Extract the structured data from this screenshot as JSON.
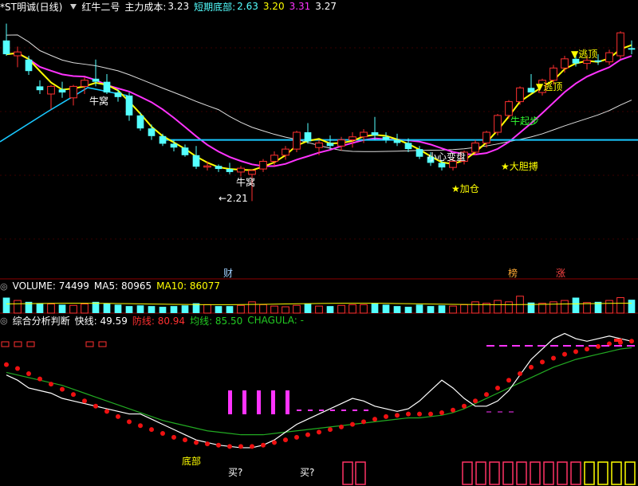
{
  "header": {
    "stock": "*ST明诚(日线)",
    "indicator": "红牛二号",
    "cost_label": "主力成本:",
    "cost_value": "3.23",
    "bottom_label": "短期底部:",
    "bottom_value": "2.63",
    "v1": "3.20",
    "v2": "3.31",
    "v3": "3.27"
  },
  "colors": {
    "up": "#ff3030",
    "down": "#54ffff",
    "fast": "#ffff00",
    "mid": "#ff33ff",
    "slow": "#dddddd",
    "support": "#19c8ff"
  },
  "main_chart": {
    "type": "candlestick",
    "support_level": 3.0,
    "low_marker": "2.21",
    "labels": {
      "nest1": "牛窝",
      "nest2": "牛窝",
      "small_change": "小心变盘",
      "add_position": "★加仓",
      "bold_buy": "★大胆搏",
      "bull_start": "牛起步",
      "escape1": "▼逃顶",
      "escape2": "▼逃顶"
    },
    "candles": [
      {
        "o": 4.3,
        "h": 4.52,
        "l": 4.1,
        "c": 4.12
      },
      {
        "o": 4.1,
        "h": 4.22,
        "l": 3.95,
        "c": 4.15
      },
      {
        "o": 4.05,
        "h": 4.1,
        "l": 3.85,
        "c": 3.9
      },
      {
        "o": 3.7,
        "h": 3.78,
        "l": 3.6,
        "c": 3.65
      },
      {
        "o": 3.6,
        "h": 3.72,
        "l": 3.4,
        "c": 3.7
      },
      {
        "o": 3.66,
        "h": 3.76,
        "l": 3.55,
        "c": 3.62
      },
      {
        "o": 3.55,
        "h": 3.72,
        "l": 3.45,
        "c": 3.7
      },
      {
        "o": 3.7,
        "h": 3.82,
        "l": 3.6,
        "c": 3.78
      },
      {
        "o": 3.8,
        "h": 4.05,
        "l": 3.7,
        "c": 3.76
      },
      {
        "o": 3.76,
        "h": 3.86,
        "l": 3.6,
        "c": 3.62
      },
      {
        "o": 3.62,
        "h": 3.66,
        "l": 3.5,
        "c": 3.56
      },
      {
        "o": 3.58,
        "h": 3.62,
        "l": 3.25,
        "c": 3.32
      },
      {
        "o": 3.32,
        "h": 3.36,
        "l": 3.12,
        "c": 3.15
      },
      {
        "o": 3.15,
        "h": 3.2,
        "l": 3.0,
        "c": 3.05
      },
      {
        "o": 3.05,
        "h": 3.08,
        "l": 2.92,
        "c": 2.95
      },
      {
        "o": 2.95,
        "h": 3.0,
        "l": 2.85,
        "c": 2.9
      },
      {
        "o": 2.9,
        "h": 2.94,
        "l": 2.78,
        "c": 2.8
      },
      {
        "o": 2.8,
        "h": 2.92,
        "l": 2.62,
        "c": 2.65
      },
      {
        "o": 2.65,
        "h": 2.72,
        "l": 2.6,
        "c": 2.66
      },
      {
        "o": 2.66,
        "h": 2.68,
        "l": 2.58,
        "c": 2.62
      },
      {
        "o": 2.62,
        "h": 2.7,
        "l": 2.55,
        "c": 2.58
      },
      {
        "o": 2.58,
        "h": 2.66,
        "l": 2.52,
        "c": 2.63
      },
      {
        "o": 2.55,
        "h": 2.62,
        "l": 2.2,
        "c": 2.6
      },
      {
        "o": 2.62,
        "h": 2.75,
        "l": 2.58,
        "c": 2.72
      },
      {
        "o": 2.72,
        "h": 2.85,
        "l": 2.66,
        "c": 2.8
      },
      {
        "o": 2.8,
        "h": 2.92,
        "l": 2.74,
        "c": 2.88
      },
      {
        "o": 2.88,
        "h": 3.12,
        "l": 2.84,
        "c": 3.1
      },
      {
        "o": 3.1,
        "h": 3.22,
        "l": 2.95,
        "c": 2.98
      },
      {
        "o": 2.9,
        "h": 3.0,
        "l": 2.8,
        "c": 2.96
      },
      {
        "o": 2.96,
        "h": 3.06,
        "l": 2.88,
        "c": 2.92
      },
      {
        "o": 2.92,
        "h": 3.04,
        "l": 2.86,
        "c": 3.0
      },
      {
        "o": 3.0,
        "h": 3.1,
        "l": 2.9,
        "c": 3.04
      },
      {
        "o": 3.04,
        "h": 3.14,
        "l": 2.96,
        "c": 3.1
      },
      {
        "o": 3.1,
        "h": 3.3,
        "l": 3.0,
        "c": 3.06
      },
      {
        "o": 3.04,
        "h": 3.1,
        "l": 2.96,
        "c": 3.0
      },
      {
        "o": 3.0,
        "h": 3.08,
        "l": 2.92,
        "c": 2.96
      },
      {
        "o": 2.96,
        "h": 3.02,
        "l": 2.84,
        "c": 2.88
      },
      {
        "o": 2.88,
        "h": 2.92,
        "l": 2.75,
        "c": 2.78
      },
      {
        "o": 2.78,
        "h": 2.84,
        "l": 2.66,
        "c": 2.7
      },
      {
        "o": 2.7,
        "h": 2.74,
        "l": 2.6,
        "c": 2.64
      },
      {
        "o": 2.64,
        "h": 2.76,
        "l": 2.6,
        "c": 2.72
      },
      {
        "o": 2.72,
        "h": 2.86,
        "l": 2.68,
        "c": 2.84
      },
      {
        "o": 2.84,
        "h": 3.0,
        "l": 2.8,
        "c": 2.96
      },
      {
        "o": 2.96,
        "h": 3.12,
        "l": 2.9,
        "c": 3.1
      },
      {
        "o": 3.1,
        "h": 3.34,
        "l": 3.06,
        "c": 3.32
      },
      {
        "o": 3.32,
        "h": 3.52,
        "l": 3.28,
        "c": 3.5
      },
      {
        "o": 3.5,
        "h": 3.7,
        "l": 3.46,
        "c": 3.68
      },
      {
        "o": 3.68,
        "h": 3.86,
        "l": 3.62,
        "c": 3.62
      },
      {
        "o": 3.62,
        "h": 3.8,
        "l": 3.58,
        "c": 3.78
      },
      {
        "o": 3.78,
        "h": 3.98,
        "l": 3.72,
        "c": 3.94
      },
      {
        "o": 3.94,
        "h": 4.1,
        "l": 3.88,
        "c": 4.06
      },
      {
        "o": 4.06,
        "h": 4.14,
        "l": 3.96,
        "c": 4.0
      },
      {
        "o": 4.0,
        "h": 4.1,
        "l": 3.92,
        "c": 4.04
      },
      {
        "o": 4.04,
        "h": 4.12,
        "l": 3.98,
        "c": 4.02
      },
      {
        "o": 4.02,
        "h": 4.18,
        "l": 3.98,
        "c": 4.14
      },
      {
        "o": 4.1,
        "h": 4.42,
        "l": 4.06,
        "c": 4.4
      },
      {
        "o": 4.2,
        "h": 4.3,
        "l": 4.12,
        "c": 4.18
      }
    ]
  },
  "volume": {
    "label": "VOLUME: 74499",
    "ma5_label": "MA5: 80965",
    "ma10_label": "MA10: 86077",
    "values": [
      2.2,
      1.8,
      1.6,
      1.4,
      1.3,
      1.2,
      1.1,
      1.3,
      1.6,
      1.4,
      1.2,
      1.0,
      1.1,
      1.0,
      0.9,
      1.0,
      1.1,
      1.4,
      1.2,
      1.0,
      1.0,
      1.1,
      1.6,
      1.2,
      1.0,
      0.9,
      1.1,
      1.3,
      1.0,
      1.0,
      1.1,
      1.2,
      1.2,
      1.4,
      1.2,
      1.0,
      0.9,
      1.2,
      1.0,
      1.1,
      1.0,
      1.2,
      1.6,
      1.4,
      1.8,
      1.6,
      2.4,
      1.5,
      1.4,
      1.6,
      1.8,
      2.2,
      1.5,
      1.6,
      1.8,
      2.2,
      1.9
    ]
  },
  "indicator": {
    "title": "综合分析判断",
    "fast_label": "快线: 49.59",
    "guard_label": "防线: 80.94",
    "avg_label": "均线: 85.50",
    "chagula_label": "CHAGULA: -",
    "bottom_text": "底部",
    "buy_text1": "买?",
    "buy_text2": "买?",
    "fast": [
      64,
      60,
      54,
      52,
      50,
      46,
      44,
      42,
      40,
      38,
      36,
      34,
      34,
      30,
      26,
      22,
      18,
      14,
      12,
      10,
      9,
      8,
      8,
      10,
      14,
      20,
      26,
      30,
      34,
      38,
      42,
      46,
      44,
      40,
      38,
      36,
      38,
      44,
      52,
      60,
      54,
      46,
      40,
      40,
      44,
      52,
      64,
      76,
      84,
      92,
      96,
      92,
      90,
      92,
      94,
      92,
      90
    ],
    "guard": [
      72,
      69,
      65,
      61,
      57,
      53,
      49,
      44,
      40,
      36,
      32,
      28,
      25,
      22,
      19,
      16,
      14,
      12,
      11,
      10,
      9,
      9,
      9,
      10,
      12,
      14,
      16,
      18,
      20,
      22,
      24,
      26,
      28,
      30,
      32,
      33,
      34,
      34,
      34,
      35,
      37,
      40,
      44,
      49,
      54,
      60,
      65,
      70,
      74,
      77,
      80,
      82,
      84,
      86,
      88,
      89,
      90
    ],
    "avg": [
      66,
      64,
      62,
      60,
      58,
      56,
      53,
      50,
      47,
      44,
      41,
      38,
      35,
      32,
      29,
      27,
      25,
      23,
      21,
      20,
      19,
      18,
      18,
      18,
      19,
      20,
      21,
      22,
      23,
      24,
      25,
      26,
      27,
      28,
      29,
      30,
      31,
      31,
      32,
      33,
      35,
      38,
      42,
      46,
      50,
      54,
      58,
      62,
      66,
      70,
      73,
      76,
      78,
      80,
      82,
      84,
      85
    ]
  },
  "markers": {
    "cai": "财",
    "bang": "榜",
    "zhang": "涨"
  }
}
